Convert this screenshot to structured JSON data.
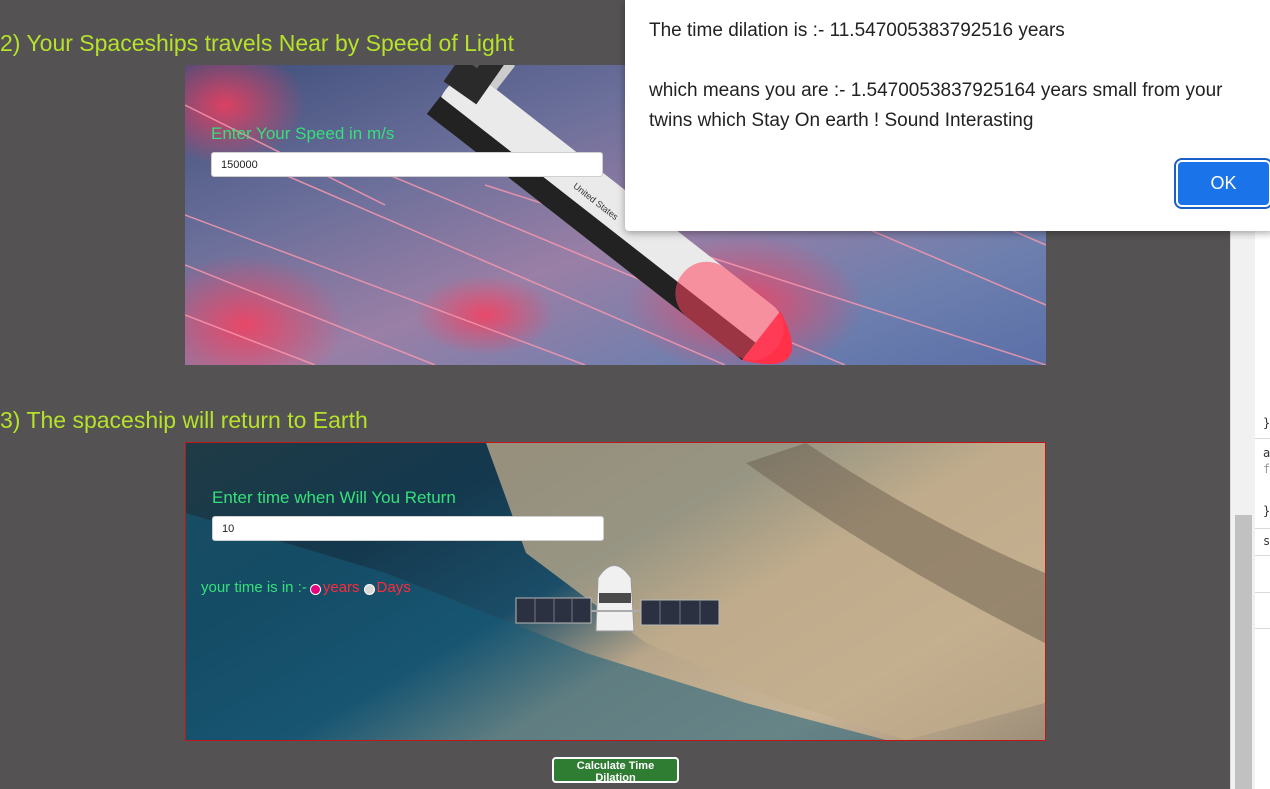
{
  "section2": {
    "title": "2) Your Spaceships travels Near by Speed of Light",
    "speed_label": "Enter Your Speed in m/s",
    "speed_value": "150000",
    "shuttle_decal": "United States"
  },
  "section3": {
    "title": "3) The spaceship will return to Earth",
    "time_label": "Enter time when Will You Return",
    "time_value": "10",
    "unit_prefix": "your time is in :-",
    "unit_options": [
      "years",
      "Days"
    ],
    "unit_selected": "years"
  },
  "calculate_button": "Calculate Time Dilation",
  "alert": {
    "line1": "The time dilation is :- 11.547005383792516 years",
    "line2": "which means you are :- 1.5470053837925164 years small from your twins which Stay On earth  ! Sound Interasting",
    "ok_label": "OK"
  },
  "devtools": {
    "snippets": [
      "}",
      "a",
      "f",
      "}",
      "s"
    ]
  },
  "colors": {
    "background": "#545252",
    "heading": "#b6e32a",
    "field_label": "#35e07a",
    "option_text": "#ff2a3a",
    "button_green": "#2e7d32",
    "alert_button": "#1a73e8"
  }
}
